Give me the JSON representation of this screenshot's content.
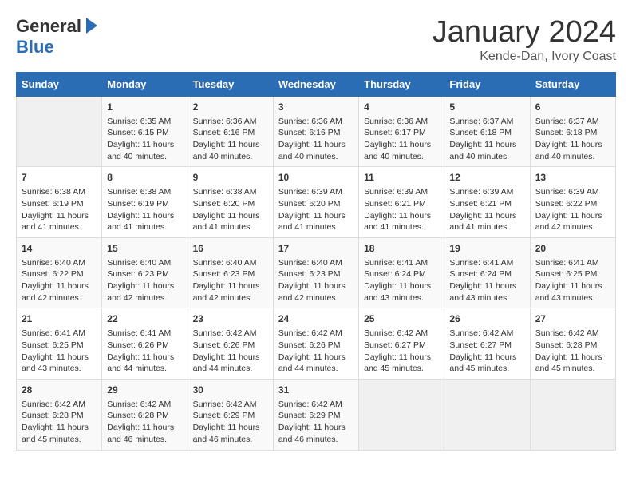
{
  "header": {
    "logo_general": "General",
    "logo_blue": "Blue",
    "title": "January 2024",
    "subtitle": "Kende-Dan, Ivory Coast"
  },
  "days_of_week": [
    "Sunday",
    "Monday",
    "Tuesday",
    "Wednesday",
    "Thursday",
    "Friday",
    "Saturday"
  ],
  "weeks": [
    [
      {
        "day": "",
        "content": ""
      },
      {
        "day": "1",
        "content": "Sunrise: 6:35 AM\nSunset: 6:15 PM\nDaylight: 11 hours and 40 minutes."
      },
      {
        "day": "2",
        "content": "Sunrise: 6:36 AM\nSunset: 6:16 PM\nDaylight: 11 hours and 40 minutes."
      },
      {
        "day": "3",
        "content": "Sunrise: 6:36 AM\nSunset: 6:16 PM\nDaylight: 11 hours and 40 minutes."
      },
      {
        "day": "4",
        "content": "Sunrise: 6:36 AM\nSunset: 6:17 PM\nDaylight: 11 hours and 40 minutes."
      },
      {
        "day": "5",
        "content": "Sunrise: 6:37 AM\nSunset: 6:18 PM\nDaylight: 11 hours and 40 minutes."
      },
      {
        "day": "6",
        "content": "Sunrise: 6:37 AM\nSunset: 6:18 PM\nDaylight: 11 hours and 40 minutes."
      }
    ],
    [
      {
        "day": "7",
        "content": "Sunrise: 6:38 AM\nSunset: 6:19 PM\nDaylight: 11 hours and 41 minutes."
      },
      {
        "day": "8",
        "content": "Sunrise: 6:38 AM\nSunset: 6:19 PM\nDaylight: 11 hours and 41 minutes."
      },
      {
        "day": "9",
        "content": "Sunrise: 6:38 AM\nSunset: 6:20 PM\nDaylight: 11 hours and 41 minutes."
      },
      {
        "day": "10",
        "content": "Sunrise: 6:39 AM\nSunset: 6:20 PM\nDaylight: 11 hours and 41 minutes."
      },
      {
        "day": "11",
        "content": "Sunrise: 6:39 AM\nSunset: 6:21 PM\nDaylight: 11 hours and 41 minutes."
      },
      {
        "day": "12",
        "content": "Sunrise: 6:39 AM\nSunset: 6:21 PM\nDaylight: 11 hours and 41 minutes."
      },
      {
        "day": "13",
        "content": "Sunrise: 6:39 AM\nSunset: 6:22 PM\nDaylight: 11 hours and 42 minutes."
      }
    ],
    [
      {
        "day": "14",
        "content": "Sunrise: 6:40 AM\nSunset: 6:22 PM\nDaylight: 11 hours and 42 minutes."
      },
      {
        "day": "15",
        "content": "Sunrise: 6:40 AM\nSunset: 6:23 PM\nDaylight: 11 hours and 42 minutes."
      },
      {
        "day": "16",
        "content": "Sunrise: 6:40 AM\nSunset: 6:23 PM\nDaylight: 11 hours and 42 minutes."
      },
      {
        "day": "17",
        "content": "Sunrise: 6:40 AM\nSunset: 6:23 PM\nDaylight: 11 hours and 42 minutes."
      },
      {
        "day": "18",
        "content": "Sunrise: 6:41 AM\nSunset: 6:24 PM\nDaylight: 11 hours and 43 minutes."
      },
      {
        "day": "19",
        "content": "Sunrise: 6:41 AM\nSunset: 6:24 PM\nDaylight: 11 hours and 43 minutes."
      },
      {
        "day": "20",
        "content": "Sunrise: 6:41 AM\nSunset: 6:25 PM\nDaylight: 11 hours and 43 minutes."
      }
    ],
    [
      {
        "day": "21",
        "content": "Sunrise: 6:41 AM\nSunset: 6:25 PM\nDaylight: 11 hours and 43 minutes."
      },
      {
        "day": "22",
        "content": "Sunrise: 6:41 AM\nSunset: 6:26 PM\nDaylight: 11 hours and 44 minutes."
      },
      {
        "day": "23",
        "content": "Sunrise: 6:42 AM\nSunset: 6:26 PM\nDaylight: 11 hours and 44 minutes."
      },
      {
        "day": "24",
        "content": "Sunrise: 6:42 AM\nSunset: 6:26 PM\nDaylight: 11 hours and 44 minutes."
      },
      {
        "day": "25",
        "content": "Sunrise: 6:42 AM\nSunset: 6:27 PM\nDaylight: 11 hours and 45 minutes."
      },
      {
        "day": "26",
        "content": "Sunrise: 6:42 AM\nSunset: 6:27 PM\nDaylight: 11 hours and 45 minutes."
      },
      {
        "day": "27",
        "content": "Sunrise: 6:42 AM\nSunset: 6:28 PM\nDaylight: 11 hours and 45 minutes."
      }
    ],
    [
      {
        "day": "28",
        "content": "Sunrise: 6:42 AM\nSunset: 6:28 PM\nDaylight: 11 hours and 45 minutes."
      },
      {
        "day": "29",
        "content": "Sunrise: 6:42 AM\nSunset: 6:28 PM\nDaylight: 11 hours and 46 minutes."
      },
      {
        "day": "30",
        "content": "Sunrise: 6:42 AM\nSunset: 6:29 PM\nDaylight: 11 hours and 46 minutes."
      },
      {
        "day": "31",
        "content": "Sunrise: 6:42 AM\nSunset: 6:29 PM\nDaylight: 11 hours and 46 minutes."
      },
      {
        "day": "",
        "content": ""
      },
      {
        "day": "",
        "content": ""
      },
      {
        "day": "",
        "content": ""
      }
    ]
  ]
}
